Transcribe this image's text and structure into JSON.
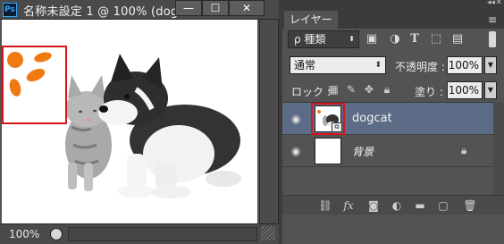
{
  "document": {
    "app_badge": "Ps",
    "title": "名称未設定 1 @ 100% (dogcat...",
    "minimize": "—",
    "maximize": "☐",
    "close": "✕",
    "zoom": "100%"
  },
  "panel": {
    "collapse": "◂◂",
    "close": "✕",
    "tab": "レイヤー",
    "menu_icon": "≡",
    "filter": {
      "kind_label": "ρ 種類",
      "icons": [
        "image-filter-icon",
        "adjustment-filter-icon",
        "type-filter-icon",
        "shape-filter-icon",
        "smart-object-filter-icon"
      ]
    },
    "blend_mode": "通常",
    "opacity_label": "不透明度 :",
    "opacity_value": "100%",
    "lock_label": "ロック :",
    "fill_label": "塗り :",
    "fill_value": "100%",
    "layers": [
      {
        "name": "dogcat",
        "selected": true,
        "visible": true
      },
      {
        "name": "背景",
        "selected": false,
        "visible": true,
        "locked": true
      }
    ],
    "bottom_icons": [
      "link-icon",
      "fx-icon",
      "mask-icon",
      "adjustment-icon",
      "group-folder-icon",
      "new-layer-icon",
      "trash-icon"
    ]
  },
  "colors": {
    "selection_highlight": "#d4161b",
    "selected_layer": "#5d6c86",
    "paint_orange": "#f07a12"
  }
}
